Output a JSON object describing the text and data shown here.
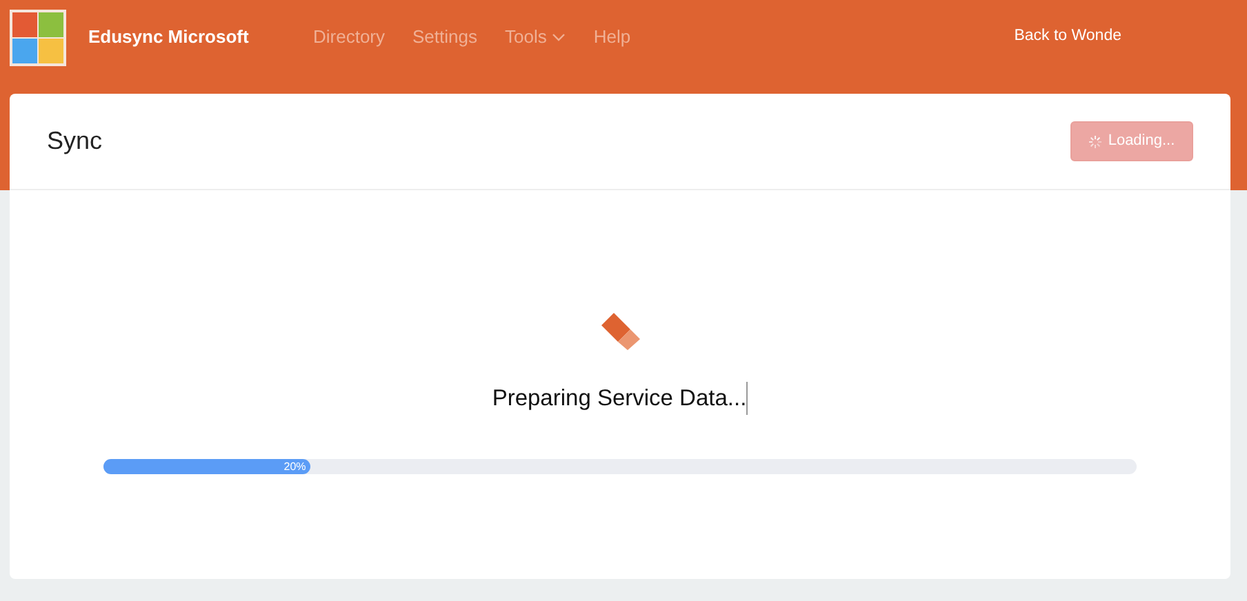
{
  "app": {
    "title": "Edusync Microsoft"
  },
  "nav": [
    {
      "label": "Directory",
      "kind": "link"
    },
    {
      "label": "Settings",
      "kind": "link"
    },
    {
      "label": "Tools",
      "kind": "dropdown"
    },
    {
      "label": "Help",
      "kind": "link"
    }
  ],
  "back_link": "Back to Wonde",
  "page": {
    "title": "Sync",
    "button": {
      "label": "Loading...",
      "disabled": true
    }
  },
  "status": {
    "message": "Preparing Service Data...",
    "progress": {
      "level": 0.2,
      "label": "20%"
    }
  }
}
